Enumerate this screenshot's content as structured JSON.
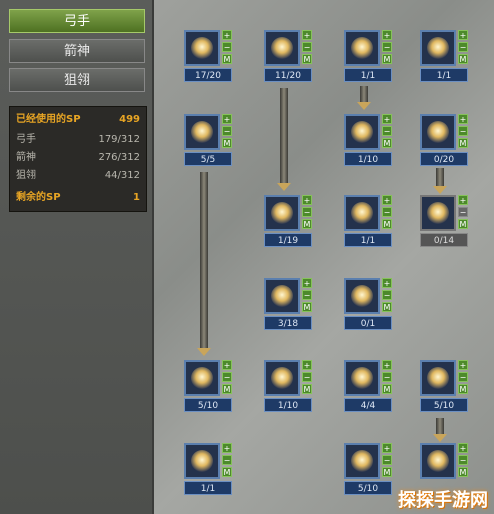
{
  "tabs": [
    {
      "label": "弓手",
      "active": true
    },
    {
      "label": "箭神",
      "active": false
    },
    {
      "label": "狙翎",
      "active": false
    }
  ],
  "sp_panel": {
    "used_label": "已经使用的SP",
    "used_value": "499",
    "rows": [
      {
        "label": "弓手",
        "value": "179/312"
      },
      {
        "label": "箭神",
        "value": "276/312"
      },
      {
        "label": "狙翎",
        "value": "44/312"
      }
    ],
    "remaining_label": "剩余的SP",
    "remaining_value": "1"
  },
  "button_labels": {
    "plus": "+",
    "minus": "−",
    "master": "M"
  },
  "skills": [
    {
      "level": "17/20",
      "icon": "bow-strike-icon",
      "locked": false
    },
    {
      "level": "11/20",
      "icon": "arrows-cross-icon",
      "locked": false
    },
    {
      "level": "1/1",
      "icon": "spirit-burst-icon",
      "locked": false
    },
    {
      "level": "1/1",
      "icon": "leaping-archer-icon",
      "locked": false
    },
    {
      "level": "5/5",
      "icon": "spin-kick-icon",
      "locked": false
    },
    {
      "level": "1/10",
      "icon": "kneel-shot-icon",
      "locked": false
    },
    {
      "level": "0/20",
      "icon": "wind-hook-icon",
      "locked": false
    },
    {
      "level": "1/19",
      "icon": "arrow-rain-icon",
      "locked": false
    },
    {
      "level": "1/1",
      "icon": "dash-figure-icon",
      "locked": false
    },
    {
      "level": "0/14",
      "icon": "fist-punch-icon",
      "locked": true
    },
    {
      "level": "3/18",
      "icon": "piercing-shot-icon",
      "locked": false
    },
    {
      "level": "0/1",
      "icon": "crouch-guard-icon",
      "locked": false
    },
    {
      "level": "5/10",
      "icon": "flip-dodge-icon",
      "locked": false
    },
    {
      "level": "1/10",
      "icon": "whirl-shot-icon",
      "locked": false
    },
    {
      "level": "4/4",
      "icon": "raised-bow-icon",
      "locked": false
    },
    {
      "level": "5/10",
      "icon": "flame-fan-icon",
      "locked": false
    },
    {
      "level": "1/1",
      "icon": "ice-burst-icon",
      "locked": false
    },
    {
      "level": "5/10",
      "icon": "flame-wing-icon",
      "locked": false
    },
    {
      "level": "",
      "icon": "flame-crest-icon",
      "locked": false
    }
  ],
  "watermark": "探探手游网"
}
